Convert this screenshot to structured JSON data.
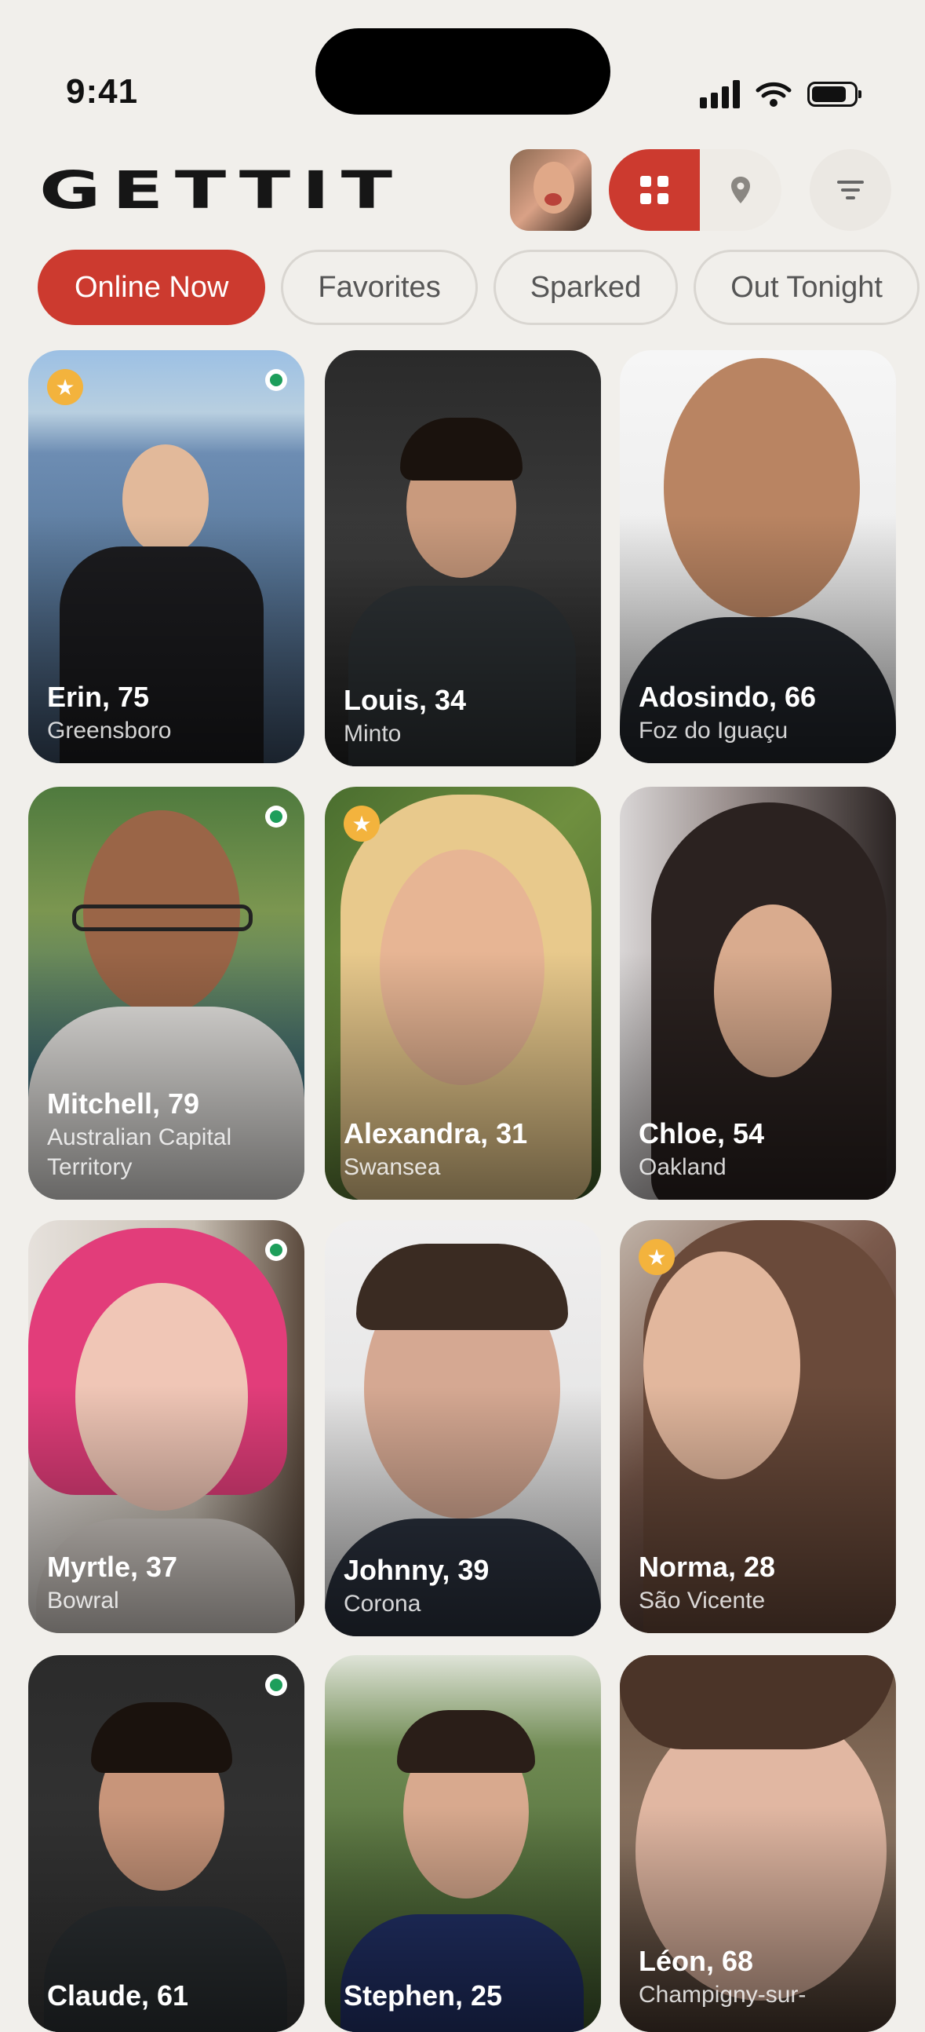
{
  "status_bar": {
    "time": "9:41"
  },
  "header": {
    "logo": "GETTIT",
    "icons": [
      "grid-icon",
      "location-pin-icon",
      "filter-icon"
    ],
    "accent_color": "#cc3a2f"
  },
  "filters": [
    {
      "label": "Online Now",
      "active": true
    },
    {
      "label": "Favorites",
      "active": false
    },
    {
      "label": "Sparked",
      "active": false
    },
    {
      "label": "Out Tonight",
      "active": false
    }
  ],
  "profiles": [
    {
      "name": "Erin, 75",
      "city": "Greensboro",
      "favorite": true,
      "online": true
    },
    {
      "name": "Louis, 34",
      "city": "Minto",
      "favorite": false,
      "online": false
    },
    {
      "name": "Adosindo, 66",
      "city": "Foz do Iguaçu",
      "favorite": false,
      "online": false
    },
    {
      "name": "Mitchell, 79",
      "city": "Australian Capital Territory",
      "favorite": false,
      "online": true
    },
    {
      "name": "Alexandra, 31",
      "city": "Swansea",
      "favorite": true,
      "online": false
    },
    {
      "name": "Chloe, 54",
      "city": "Oakland",
      "favorite": false,
      "online": false
    },
    {
      "name": "Myrtle, 37",
      "city": "Bowral",
      "favorite": false,
      "online": true
    },
    {
      "name": "Johnny, 39",
      "city": "Corona",
      "favorite": false,
      "online": false
    },
    {
      "name": "Norma, 28",
      "city": "São Vicente",
      "favorite": true,
      "online": false
    },
    {
      "name": "Claude, 61",
      "city": "",
      "favorite": false,
      "online": true
    },
    {
      "name": "Stephen, 25",
      "city": "",
      "favorite": false,
      "online": false
    },
    {
      "name": "Léon, 68",
      "city": "Champigny-sur-",
      "favorite": false,
      "online": false
    }
  ],
  "colors": {
    "star": "#f3b33d",
    "online": "#1d9e5b",
    "background": "#f1efeb"
  }
}
